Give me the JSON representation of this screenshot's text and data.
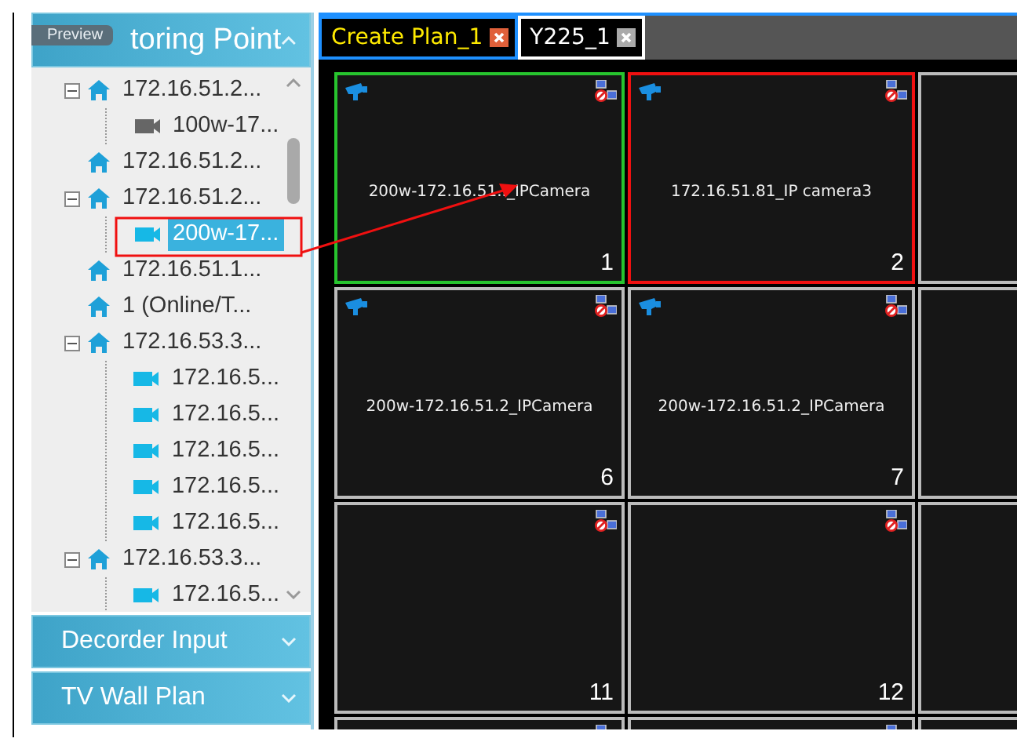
{
  "sidebar": {
    "header": {
      "title": "toring Point",
      "expanded": true
    },
    "tree": [
      {
        "kind": "device",
        "label": "172.16.51.2...",
        "expanded": true,
        "selected": false,
        "children": [
          {
            "kind": "camera",
            "label": "100w-17...",
            "online": false,
            "selected": false
          }
        ]
      },
      {
        "kind": "device",
        "label": "172.16.51.2...",
        "selected": false
      },
      {
        "kind": "device",
        "label": "172.16.51.2...",
        "expanded": true,
        "selected": false,
        "children": [
          {
            "kind": "camera",
            "label": "200w-17...",
            "online": true,
            "selected": true
          }
        ]
      },
      {
        "kind": "device",
        "label": "172.16.51.1...",
        "selected": false
      },
      {
        "kind": "device",
        "label": "1 (Online/T...",
        "selected": false
      },
      {
        "kind": "device",
        "label": "172.16.53.3...",
        "expanded": true,
        "selected": false,
        "children": [
          {
            "kind": "camera",
            "label": "172.16.5...",
            "online": true,
            "selected": false
          },
          {
            "kind": "camera",
            "label": "172.16.5...",
            "online": true,
            "selected": false
          },
          {
            "kind": "camera",
            "label": "172.16.5...",
            "online": true,
            "selected": false
          },
          {
            "kind": "camera",
            "label": "172.16.5...",
            "online": true,
            "selected": false
          },
          {
            "kind": "camera",
            "label": "172.16.5...",
            "online": true,
            "selected": false
          }
        ]
      },
      {
        "kind": "device",
        "label": "172.16.53.3...",
        "expanded": true,
        "selected": false,
        "children": [
          {
            "kind": "camera",
            "label": "172.16.5...",
            "online": true,
            "selected": false
          }
        ]
      }
    ],
    "sections": [
      {
        "title": "Decorder Input",
        "expanded": false
      },
      {
        "title": "TV Wall Plan",
        "expanded": false
      }
    ]
  },
  "tabs": [
    {
      "label": "Create Plan_1",
      "selected": true
    },
    {
      "label": "Y225_1",
      "selected": false
    }
  ],
  "tiles": [
    {
      "active": true,
      "selected": false,
      "camera": true,
      "label": "200w-172.16.51.._IPCamera",
      "number": "1"
    },
    {
      "active": false,
      "selected": true,
      "camera": true,
      "label": "172.16.51.81_IP camera3",
      "number": "2"
    },
    {
      "active": false,
      "selected": false,
      "camera": false,
      "status_icon": false
    },
    {
      "active": false,
      "selected": false,
      "camera": true,
      "label": "200w-172.16.51.2_IPCamera",
      "number": "6"
    },
    {
      "active": false,
      "selected": false,
      "camera": true,
      "label": "200w-172.16.51.2_IPCamera",
      "number": "7"
    },
    {
      "active": false,
      "selected": false,
      "camera": false,
      "status_icon": false
    },
    {
      "active": false,
      "selected": false,
      "camera": false,
      "number": "11"
    },
    {
      "active": false,
      "selected": false,
      "camera": false,
      "number": "12"
    },
    {
      "active": false,
      "selected": false,
      "camera": false,
      "status_icon": false
    },
    {
      "active": false,
      "selected": false,
      "camera": false
    },
    {
      "active": false,
      "selected": false,
      "camera": false
    },
    {
      "active": false,
      "selected": false,
      "camera": false,
      "status_icon": false
    }
  ],
  "annotation": {
    "drag_label": "Preview"
  }
}
